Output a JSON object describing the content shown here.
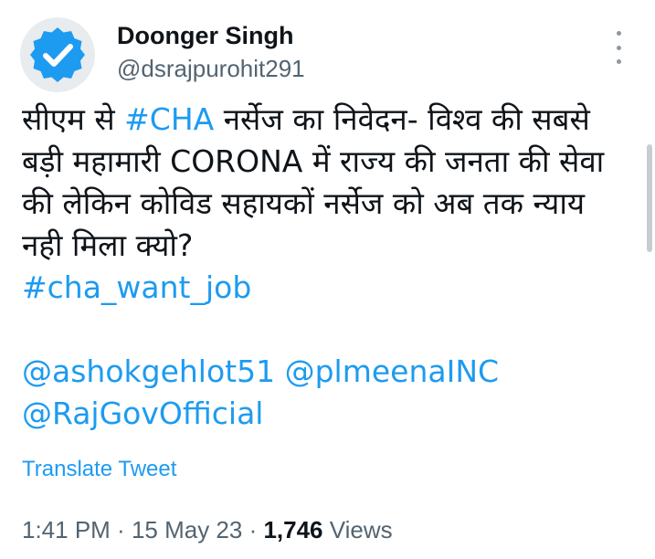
{
  "user": {
    "display_name": "Doonger Singh",
    "handle": "@dsrajpurohit291",
    "avatar_icon": "verified-badge-icon"
  },
  "tweet": {
    "line1_pre": "सीएम से ",
    "line1_hashtag": "#CHA",
    "line1_post": " नर्सेज का निवेदन- विश्व की सबसे",
    "line2": "बड़ी महामारी CORONA में राज्य की जनता की सेवा",
    "line3": "की लेकिन कोविड सहायकों नर्सेज को अब तक न्याय",
    "line4": "नही मिला क्यो?",
    "hashtag2": "#cha_want_job",
    "mention1": "@ashokgehlot51",
    "mention2": "@plmeenaINC",
    "mention3": "@RajGovOfficial"
  },
  "translate_label": "Translate Tweet",
  "meta": {
    "time": "1:41 PM",
    "sep1": " · ",
    "date": "15 May 23",
    "sep2": " · ",
    "views_count": "1,746",
    "views_label": " Views"
  },
  "colors": {
    "link": "#1d9bf0",
    "text": "#0f1419",
    "secondary": "#536471"
  }
}
